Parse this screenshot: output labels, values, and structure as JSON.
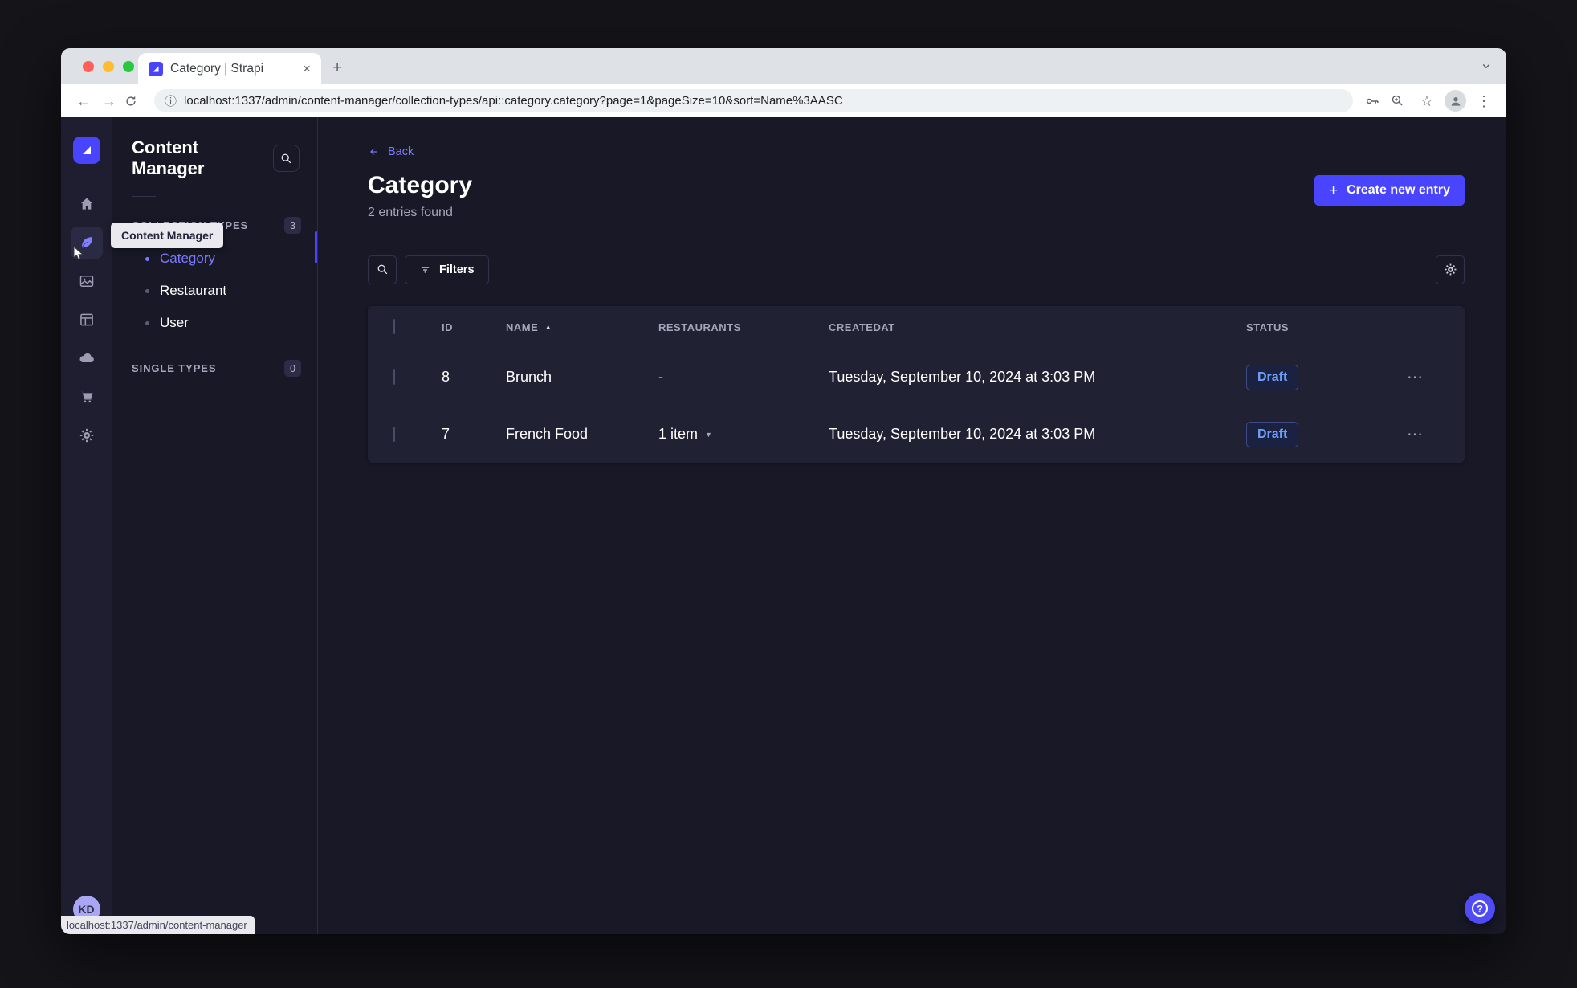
{
  "browser": {
    "tab_title": "Category | Strapi",
    "url": "localhost:1337/admin/content-manager/collection-types/api::category.category?page=1&pageSize=10&sort=Name%3AASC"
  },
  "icons": {
    "close_tab": "×",
    "new_tab": "+",
    "back_arrow": "←",
    "forward_arrow": "→",
    "info": "ⓘ",
    "star": "☆",
    "menu_dots_v": "⋮",
    "menu_dots_h": "⋯",
    "plus": "+",
    "sort_asc": "▲",
    "caret_down": "▼",
    "help": "?"
  },
  "nav_rail": {
    "tooltip": "Content Manager",
    "avatar_initials": "KD"
  },
  "sidebar": {
    "title": "Content Manager",
    "collection_types": {
      "label": "COLLECTION TYPES",
      "count": "3",
      "items": [
        "Category",
        "Restaurant",
        "User"
      ],
      "active_item": "Category"
    },
    "single_types": {
      "label": "SINGLE TYPES",
      "count": "0"
    }
  },
  "main": {
    "back": "Back",
    "title": "Category",
    "subtitle": "2 entries found",
    "create_button": "Create new entry",
    "filters_button": "Filters",
    "table": {
      "headers": {
        "id": "ID",
        "name": "NAME",
        "restaurants": "RESTAURANTS",
        "created_at": "CREATEDAT",
        "status": "STATUS"
      },
      "rows": [
        {
          "id": "8",
          "name": "Brunch",
          "restaurants": "-",
          "created_at": "Tuesday, September 10, 2024 at 3:03 PM",
          "status": "Draft"
        },
        {
          "id": "7",
          "name": "French Food",
          "restaurants": "1 item",
          "created_at": "Tuesday, September 10, 2024 at 3:03 PM",
          "status": "Draft"
        }
      ]
    }
  },
  "status_bar": {
    "link_preview": "localhost:1337/admin/content-manager"
  },
  "colors": {
    "primary": "#4945ff",
    "link": "#7b79ff",
    "draft_text": "#6f9ff8",
    "app_bg": "#181826",
    "card_bg": "#212134"
  }
}
